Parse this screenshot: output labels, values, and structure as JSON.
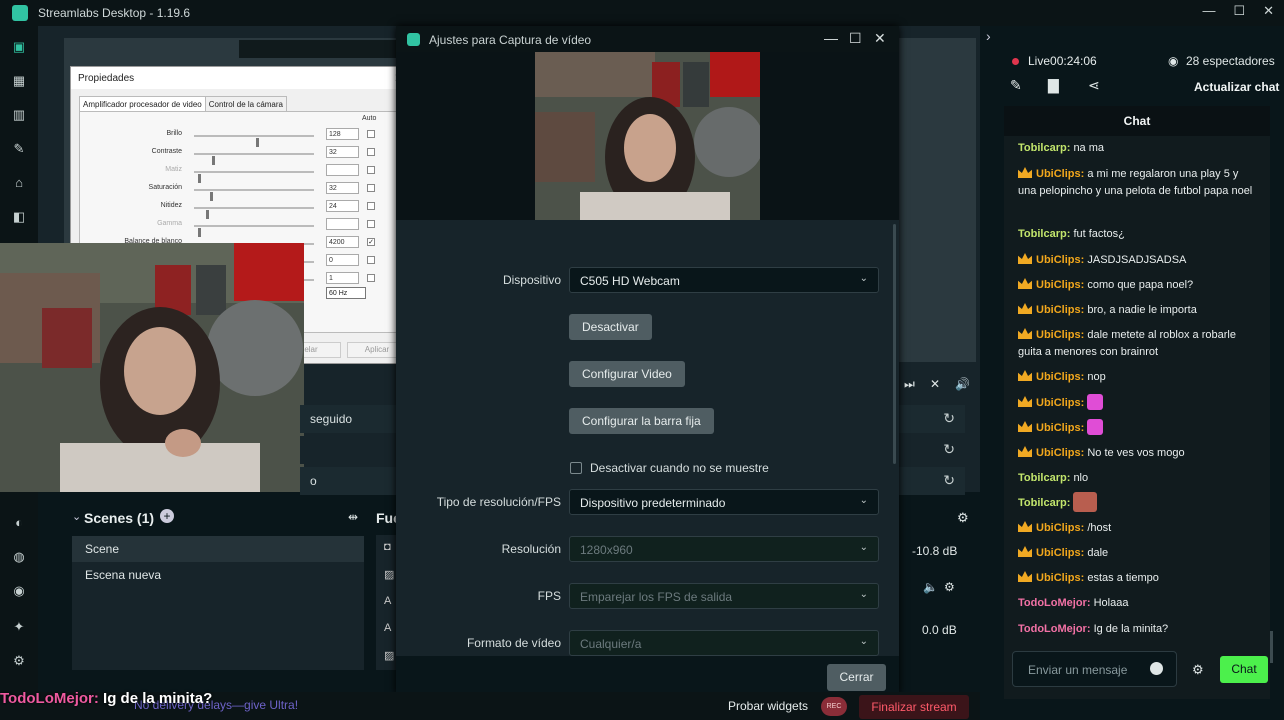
{
  "app": {
    "title": "Streamlabs Desktop - 1.19.6"
  },
  "properties_window": {
    "title": "Propiedades",
    "tabs": [
      "Amplificador procesador de video",
      "Control de la cámara"
    ],
    "auto_label": "Auto",
    "rows": [
      {
        "label": "Brillo",
        "value": "128",
        "enabled": true,
        "checked": false
      },
      {
        "label": "Contraste",
        "value": "32",
        "enabled": true,
        "checked": false
      },
      {
        "label": "Matiz",
        "value": "",
        "enabled": false,
        "checked": false
      },
      {
        "label": "Saturación",
        "value": "32",
        "enabled": true,
        "checked": false
      },
      {
        "label": "Nitidez",
        "value": "24",
        "enabled": true,
        "checked": false
      },
      {
        "label": "Gamma",
        "value": "",
        "enabled": false,
        "checked": false
      },
      {
        "label": "Balance de blanco",
        "value": "4200",
        "enabled": true,
        "checked": true
      },
      {
        "label": "",
        "value": "0",
        "enabled": true,
        "checked": false
      },
      {
        "label": "",
        "value": "1",
        "enabled": true,
        "checked": false
      }
    ],
    "frequency": "60 Hz",
    "cancel_partial": "elar",
    "apply_label": "Aplicar"
  },
  "editor": {
    "row_label_1": "seguido",
    "row_label_2": "o"
  },
  "scenes": {
    "header": "Scenes (1)",
    "items": [
      "Scene",
      "Escena nueva"
    ]
  },
  "sources_header": "Fue",
  "mixer": {
    "db1": "-10.8 dB",
    "db2": "0.0 dB"
  },
  "dialog": {
    "title": "Ajustes para Captura de vídeo",
    "device_label": "Dispositivo",
    "device_value": "C505 HD Webcam",
    "btn_deactivate": "Desactivar",
    "btn_config_video": "Configurar Video",
    "btn_config_bar": "Configurar la barra fija",
    "checkbox_label": "Desactivar cuando no se muestre",
    "res_type_label": "Tipo de resolución/FPS",
    "res_type_value": "Dispositivo predeterminado",
    "resolution_label": "Resolución",
    "resolution_value": "1280x960",
    "fps_label": "FPS",
    "fps_value": "Emparejar los FPS de salida",
    "format_label": "Formato de vídeo",
    "format_value": "Cualquier/a",
    "close_label": "Cerrar"
  },
  "chat_panel": {
    "live_label": "Live",
    "live_time": "00:24:06",
    "viewers": "28 espectadores",
    "refresh_label": "Actualizar chat",
    "header": "Chat",
    "messages": [
      {
        "user": "Tobilcarp",
        "crown": false,
        "text": "na ma",
        "ucls": "u-tob"
      },
      {
        "user": "UbiClips",
        "crown": true,
        "text": "a mi me regalaron una play 5 y una pelopincho y una pelota de futbol papa noel",
        "ucls": "u-ubi"
      },
      {
        "user": "Tobilcarp",
        "crown": false,
        "text": "fut factos¿",
        "ucls": "u-tob"
      },
      {
        "user": "UbiClips",
        "crown": true,
        "text": "JASDJSADJSADSA",
        "ucls": "u-ubi"
      },
      {
        "user": "UbiClips",
        "crown": true,
        "text": "como que papa noel?",
        "ucls": "u-ubi"
      },
      {
        "user": "UbiClips",
        "crown": true,
        "text": "bro, a nadie le importa",
        "ucls": "u-ubi"
      },
      {
        "user": "UbiClips",
        "crown": true,
        "text": "dale metete al roblox a robarle guita a menores con brainrot",
        "ucls": "u-ubi"
      },
      {
        "user": "UbiClips",
        "crown": true,
        "text": "nop",
        "ucls": "u-ubi"
      },
      {
        "user": "UbiClips",
        "crown": true,
        "text": "",
        "emote": true,
        "ucls": "u-ubi"
      },
      {
        "user": "UbiClips",
        "crown": true,
        "text": "",
        "emote": true,
        "ucls": "u-ubi"
      },
      {
        "user": "UbiClips",
        "crown": true,
        "text": "No te ves vos mogo",
        "ucls": "u-ubi"
      },
      {
        "user": "Tobilcarp",
        "crown": false,
        "text": "nlo",
        "ucls": "u-tob"
      },
      {
        "user": "Tobilcarp",
        "crown": false,
        "text": "",
        "image": true,
        "ucls": "u-tob"
      },
      {
        "user": "UbiClips",
        "crown": true,
        "text": "/host",
        "ucls": "u-ubi"
      },
      {
        "user": "UbiClips",
        "crown": true,
        "text": "dale",
        "ucls": "u-ubi"
      },
      {
        "user": "UbiClips",
        "crown": true,
        "text": "estas a tiempo",
        "ucls": "u-ubi"
      },
      {
        "user": "TodoLoMejor",
        "crown": false,
        "text": "Holaaa",
        "ucls": "u-todo"
      },
      {
        "user": "TodoLoMejor",
        "crown": false,
        "text": "Ig de la minita?",
        "ucls": "u-todo"
      }
    ],
    "input_placeholder": "Enviar un mensaje",
    "send_label": "Chat"
  },
  "bottom_bar": {
    "ultra_text": "No delivery delays—give Ultra!",
    "test_widgets": "Probar widgets",
    "rec_label": "REC",
    "end_stream": "Finalizar stream"
  },
  "caption": {
    "user": "TodoLoMejor:",
    "message": "Ig de la minita?"
  }
}
